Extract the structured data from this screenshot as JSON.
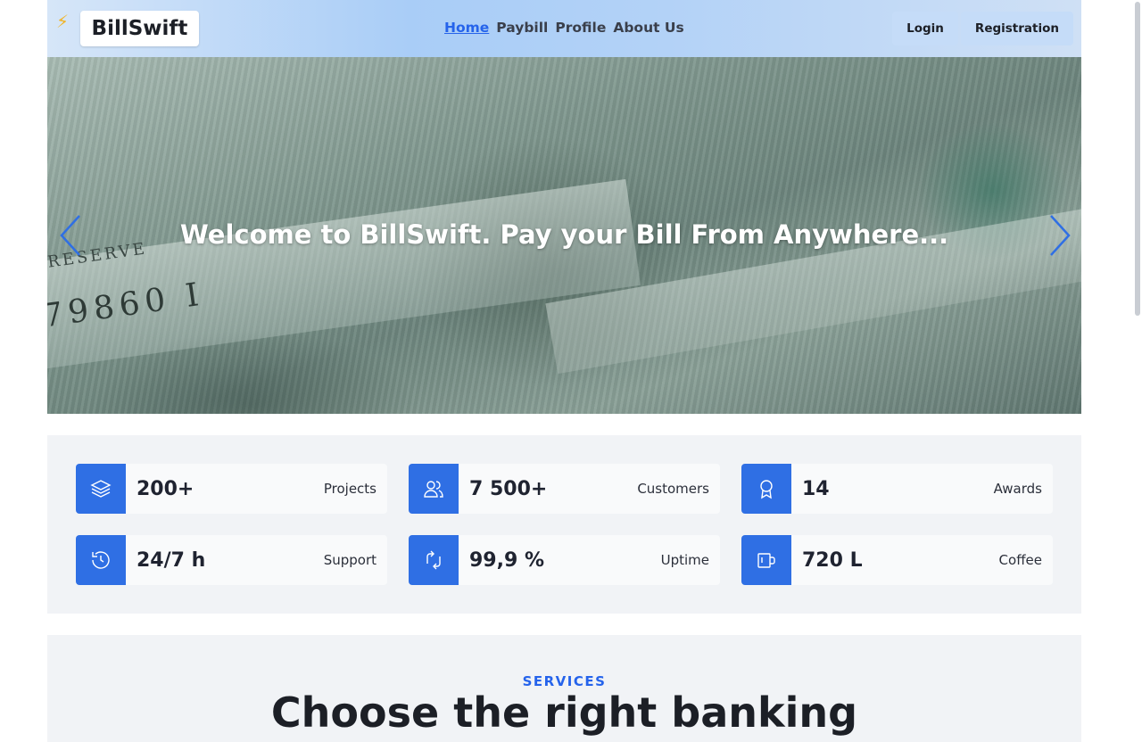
{
  "header": {
    "brand": "BillSwift",
    "nav": [
      {
        "label": "Home",
        "active": true
      },
      {
        "label": "Paybill"
      },
      {
        "label": "Profile"
      },
      {
        "label": "About Us"
      }
    ],
    "login_label": "Login",
    "register_label": "Registration"
  },
  "hero": {
    "title": "Welcome to BillSwift. Pay your Bill From Anywhere...",
    "note_serial": "79860 I",
    "note_reserve": "RESERVE"
  },
  "stats": [
    {
      "value": "200+",
      "label": "Projects",
      "icon": "layers-icon"
    },
    {
      "value": "7 500+",
      "label": "Customers",
      "icon": "users-icon"
    },
    {
      "value": "14",
      "label": "Awards",
      "icon": "award-icon"
    },
    {
      "value": "24/7 h",
      "label": "Support",
      "icon": "history-icon"
    },
    {
      "value": "99,9 %",
      "label": "Uptime",
      "icon": "refresh-icon"
    },
    {
      "value": "720 L",
      "label": "Coffee",
      "icon": "coffee-cup-icon"
    }
  ],
  "services": {
    "kicker": "SERVICES",
    "title": "Choose the right banking"
  },
  "colors": {
    "accent": "#2f6fe4",
    "link_active": "#2563eb"
  }
}
